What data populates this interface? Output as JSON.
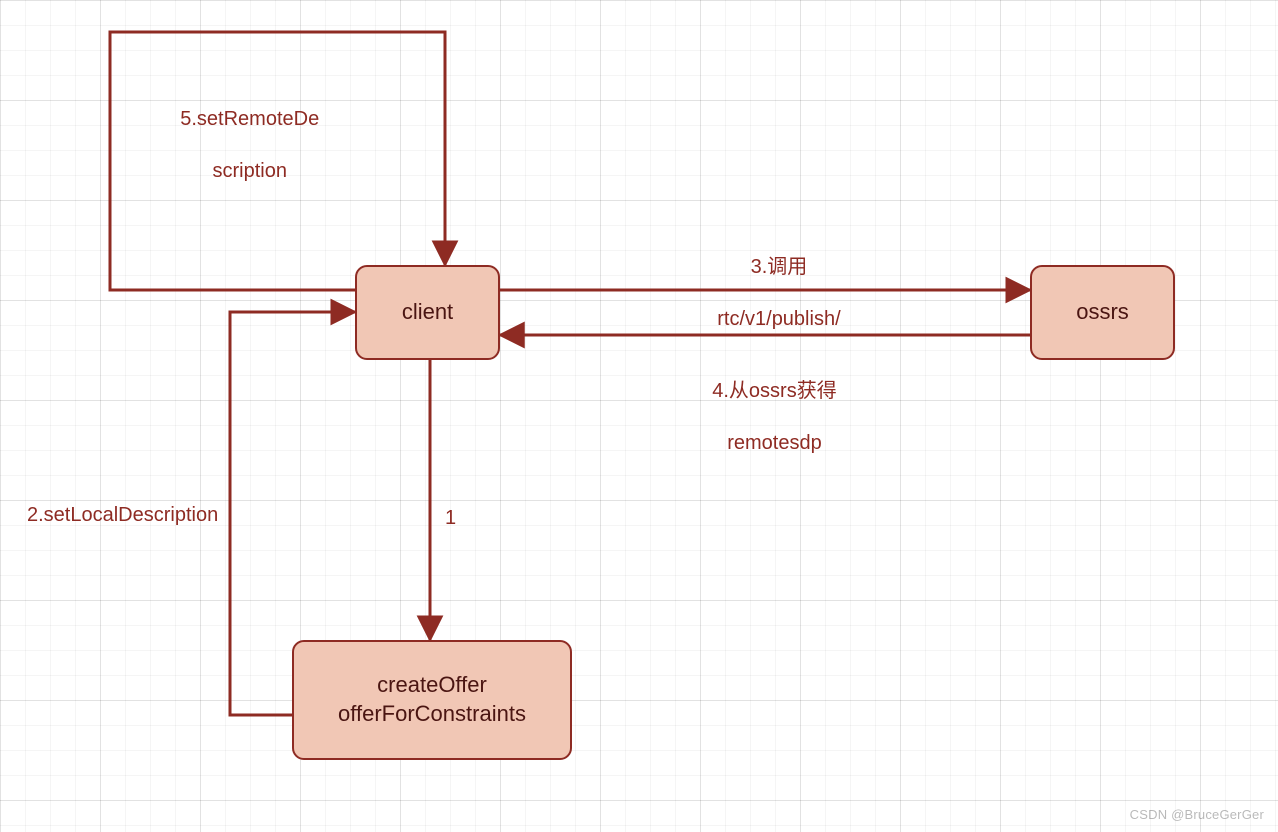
{
  "colors": {
    "stroke": "#8e2b23",
    "fill": "#f1c7b5",
    "text": "#4a1512"
  },
  "nodes": {
    "client": {
      "label": "client"
    },
    "ossrs": {
      "label": "ossrs"
    },
    "createOffer": {
      "line1": "createOffer",
      "line2": "offerForConstraints"
    }
  },
  "edges": {
    "e1_label": "1",
    "e2_label": "2.setLocalDescription",
    "e3_line1": "3.调用",
    "e3_line2": "rtc/v1/publish/",
    "e4_line1": "4.从ossrs获得",
    "e4_line2": "remotesdp",
    "e5_line1": "5.setRemoteDe",
    "e5_line2": "scription"
  },
  "watermark": "CSDN @BruceGerGer"
}
